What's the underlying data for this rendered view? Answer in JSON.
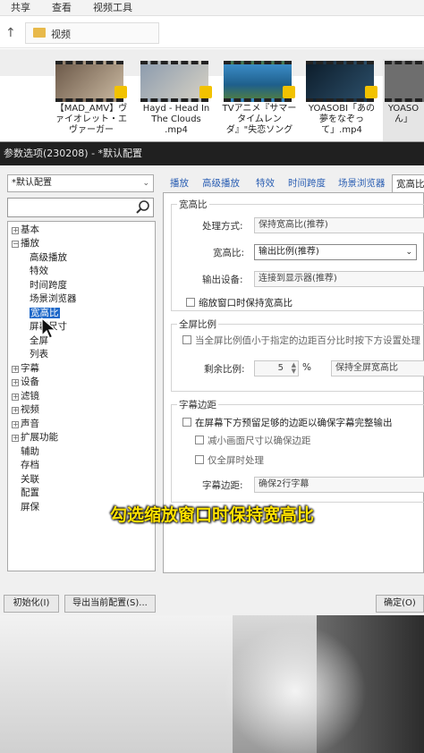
{
  "explorer": {
    "ribbon": [
      "共享",
      "查看",
      "视频工具"
    ],
    "breadcrumb": "视频",
    "files": [
      {
        "name": "【MAD_AMV】ヴァイオレット・エヴァーガー"
      },
      {
        "name": "Hayd - Head In The Clouds .mp4"
      },
      {
        "name": "TVアニメ『サマータイムレンダ』\"失恋ソング"
      },
      {
        "name": "YOASOBI「あの夢をなぞって」.mp4"
      },
      {
        "name": "YOASO ん」"
      }
    ]
  },
  "dialog": {
    "title": "参数选项(230208) - *默认配置",
    "profile": "*默认配置",
    "tree": [
      "基本",
      "播放",
      "高级播放",
      "特效",
      "时间跨度",
      "场景浏览器",
      "宽高比",
      "屏幕尺寸",
      "全屏",
      "列表",
      "字幕",
      "设备",
      "滤镜",
      "视频",
      "声音",
      "扩展功能",
      "辅助",
      "存档",
      "关联",
      "配置",
      "屏保"
    ],
    "tabs": [
      "播放",
      "高级播放",
      "特效",
      "时间跨度",
      "场景浏览器",
      "宽高比"
    ],
    "aspect": {
      "group_title": "宽高比",
      "method_label": "处理方式:",
      "method_value": "保持宽高比(推荐)",
      "ratio_label": "宽高比:",
      "ratio_value": "输出比例(推荐)",
      "device_label": "输出设备:",
      "device_value": "连接到显示器(推荐)",
      "keep_on_zoom": "缩放窗口时保持宽高比"
    },
    "fullscreen": {
      "group_title": "全屏比例",
      "check": "当全屏比例值小于指定的边距百分比时按下方设置处理",
      "remain_label": "剩余比例:",
      "remain_value": "5",
      "percent": "%",
      "remain_mode": "保持全屏宽高比"
    },
    "margin": {
      "group_title": "字幕边距",
      "check1": "在屏幕下方预留足够的边距以确保字幕完整输出",
      "check2": "减小画面尺寸以确保边距",
      "check3": "仅全屏时处理",
      "margin_label": "字幕边距:",
      "margin_value": "确保2行字幕"
    },
    "buttons": {
      "init": "初始化(I)",
      "export": "导出当前配置(S)...",
      "ok": "确定(O)"
    }
  },
  "subtitle": "勾选缩放窗口时保持宽高比"
}
